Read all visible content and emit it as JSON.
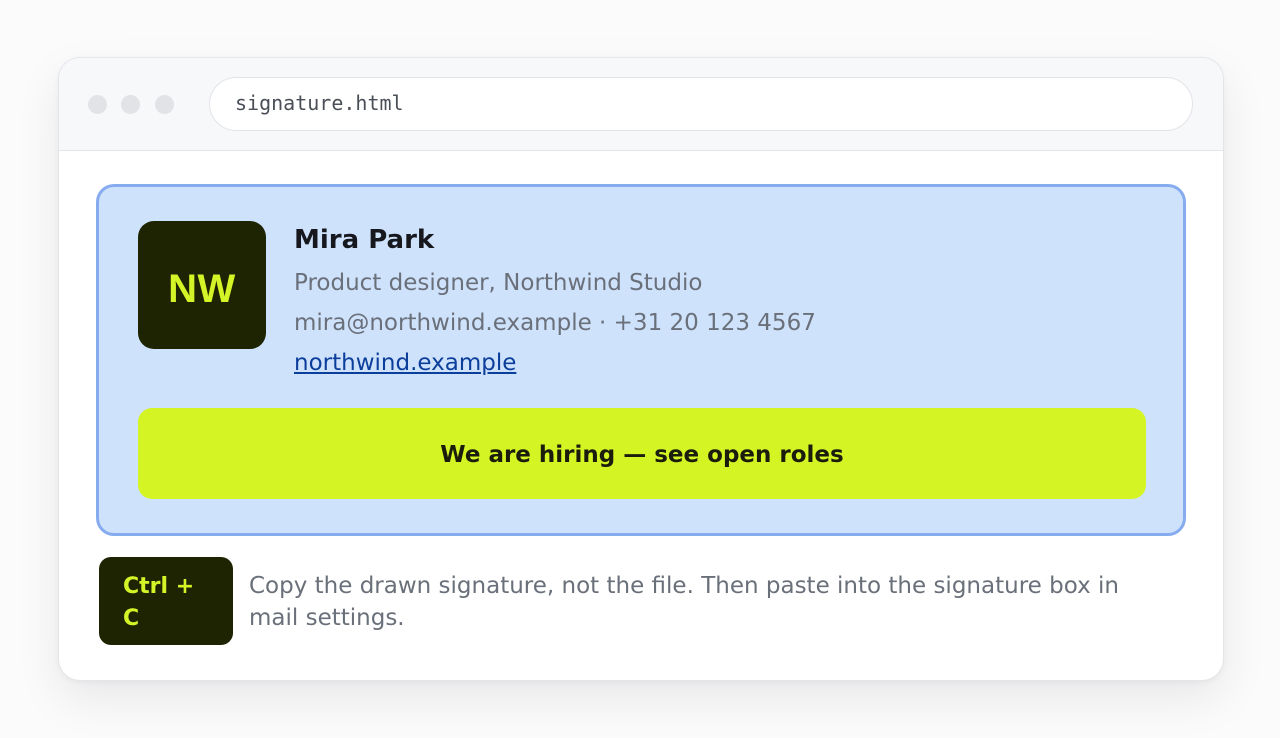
{
  "window": {
    "url": "signature.html"
  },
  "signature": {
    "logo_text": "NW",
    "name": "Mira Park",
    "title": "Product designer, Northwind Studio",
    "contact": "mira@northwind.example · +31 20 123 4567",
    "website": "northwind.example",
    "cta_label": "We are hiring — see open roles"
  },
  "hint": {
    "shortcut": "Ctrl + C",
    "text": "Copy the drawn signature, not the file. Then paste into the signature box in mail settings."
  },
  "colors": {
    "card_background": "#cfe2fc",
    "card_border": "#86acef",
    "brand_dark": "#1e2401",
    "brand_accent": "#d5f424",
    "link": "#0b3f9b"
  }
}
